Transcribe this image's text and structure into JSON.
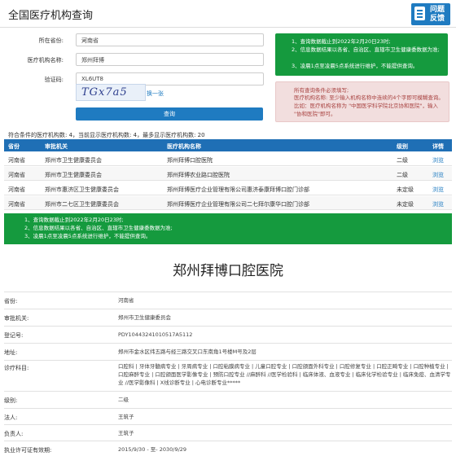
{
  "header": {
    "title": "全国医疗机构查询",
    "help_label_1": "问题",
    "help_label_2": "反馈"
  },
  "form": {
    "province_label": "所在省份:",
    "province_value": "河南省",
    "name_label": "医疗机构名称:",
    "name_value": "郑州拜博",
    "code_label": "验证码:",
    "code_value": "XL6UT8",
    "captcha_text": "TGx7a5",
    "refresh_label": "换一张",
    "query_button": "查询"
  },
  "notes": {
    "green": [
      "1、查询数据截止到2022年2月20日23时;",
      "2、信息数据结果以各省、自治区、直辖市卫生健康委数据为准;",
      "3、凌晨1点至凌晨5点系统进行维护，不能提供查询。"
    ],
    "tips": [
      "所有查询条件必须填写;",
      "医疗机构名称: 至少输入机构名称中连续的4个字即可模糊查询。比如：医疗机构名称为 \"中国医学科学院北京协和医院\"，输入 \"协和医院\"即可。"
    ],
    "bottom": [
      "1、查询数据截止到2022年2月20日23时;",
      "2、信息数据结果以各省、自治区、直辖市卫生健康委数据为准;",
      "3、凌晨1点至凌晨5点系统进行维护，不能提供查询。"
    ]
  },
  "stats": "符合条件的医疗机构数: 4，当前显示医疗机构数: 4，最多显示医疗机构数: 20",
  "table": {
    "headers": [
      "省份",
      "审批机关",
      "医疗机构名称",
      "级别",
      "详情"
    ],
    "rows": [
      [
        "河南省",
        "郑州市卫生健康委员会",
        "郑州拜博口腔医院",
        "二级",
        "浏览"
      ],
      [
        "河南省",
        "郑州市卫生健康委员会",
        "郑州拜博农业路口腔医院",
        "二级",
        "浏览"
      ],
      [
        "河南省",
        "郑州市惠济区卫生健康委员会",
        "郑州拜博医疗企业管理有限公司惠济泰康拜博口腔门诊部",
        "未定级",
        "浏览"
      ],
      [
        "河南省",
        "郑州市二七区卫生健康委员会",
        "郑州拜博医疗企业管理有限公司二七拜尔康华口腔门诊部",
        "未定级",
        "浏览"
      ]
    ]
  },
  "detail": {
    "hospital_name": "郑州拜博口腔医院",
    "rows": [
      {
        "label": "省份:",
        "value": "河南省"
      },
      {
        "label": "审批机关:",
        "value": "郑州市卫生健康委员会"
      },
      {
        "label": "登记号:",
        "value": "PDY10443241010517A5112"
      },
      {
        "label": "地址:",
        "value": "郑州市金水区纬五路与经三路交叉口东南角1号楼M号及2层"
      },
      {
        "label": "诊疗科目:",
        "value": "口腔科 | 牙体牙髓病专业 | 牙周病专业 | 口腔粘膜病专业 | 儿童口腔专业 | 口腔颌面外科专业 | 口腔修复专业 | 口腔正畸专业 | 口腔种植专业 | 口腔麻醉专业 | 口腔颌面医学影像专业 | 预防口腔专业 //麻醉科 //医学检验科 | 临床体液、血液专业 | 临床化学检验专业 | 临床免疫、血清学专业 //医学影像科 | X线诊断专业 | 心电诊断专业*****"
      },
      {
        "label": "级别:",
        "value": "二级"
      },
      {
        "label": "法人:",
        "value": "王筑子"
      },
      {
        "label": "负责人:",
        "value": "王筑子"
      },
      {
        "label": "执业许可证有效期:",
        "value": "2015/9/30 - 至- 2030/9/29"
      }
    ]
  }
}
